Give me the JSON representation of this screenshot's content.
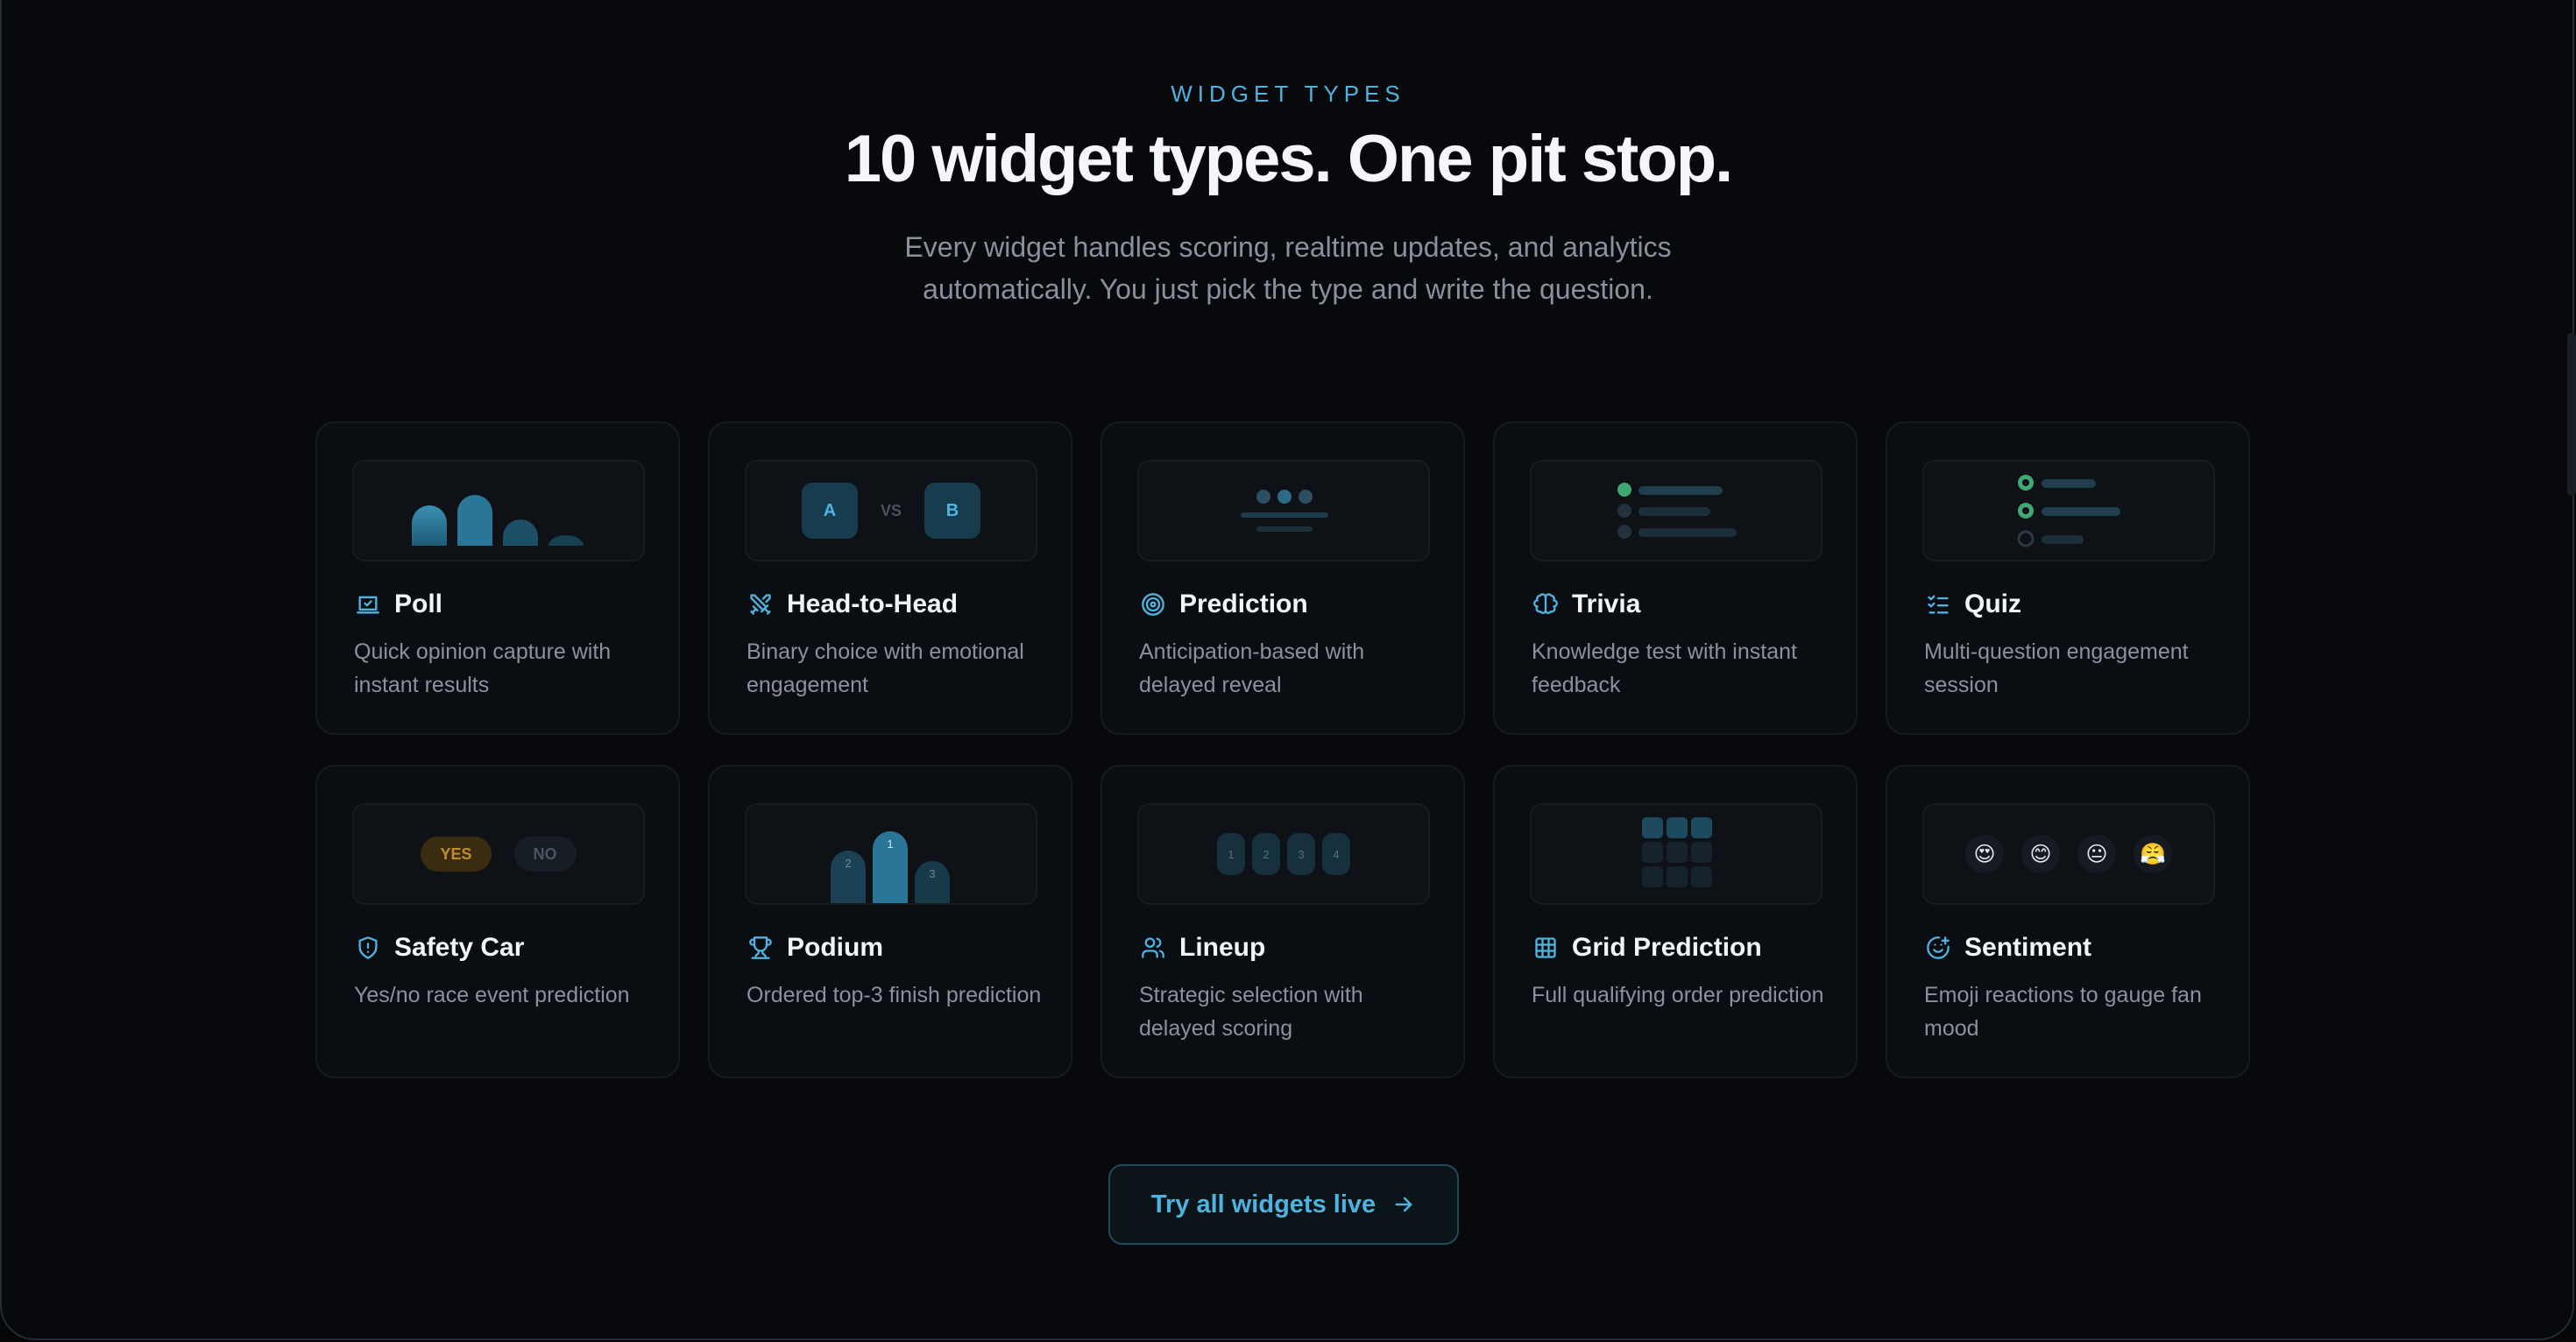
{
  "section": {
    "eyebrow": "WIDGET TYPES",
    "headline": "10 widget types. One pit stop.",
    "subhead": "Every widget handles scoring, realtime updates, and analytics automatically. You just pick the type and write the question."
  },
  "colors": {
    "accent": "#4fb3e0",
    "green": "#3fa772",
    "amber": "#c08b2a",
    "card_bg": "#0a0d11"
  },
  "widgets": [
    {
      "title": "Poll",
      "desc": "Quick opinion capture with instant results",
      "icon": "poll-icon"
    },
    {
      "title": "Head-to-Head",
      "desc": "Binary choice with emotional engagement",
      "icon": "swords-icon",
      "preview": {
        "a": "A",
        "vs": "VS",
        "b": "B"
      }
    },
    {
      "title": "Prediction",
      "desc": "Anticipation-based with delayed reveal",
      "icon": "target-icon"
    },
    {
      "title": "Trivia",
      "desc": "Knowledge test with instant feedback",
      "icon": "brain-icon"
    },
    {
      "title": "Quiz",
      "desc": "Multi-question engagement session",
      "icon": "list-checks-icon"
    },
    {
      "title": "Safety Car",
      "desc": "Yes/no race event prediction",
      "icon": "shield-icon",
      "preview": {
        "yes": "YES",
        "no": "NO"
      }
    },
    {
      "title": "Podium",
      "desc": "Ordered top-3 finish prediction",
      "icon": "trophy-icon",
      "preview": {
        "p1": "1",
        "p2": "2",
        "p3": "3"
      }
    },
    {
      "title": "Lineup",
      "desc": "Strategic selection with delayed scoring",
      "icon": "users-icon",
      "preview": {
        "slots": [
          "1",
          "2",
          "3",
          "4"
        ]
      }
    },
    {
      "title": "Grid Prediction",
      "desc": "Full qualifying order prediction",
      "icon": "grid-icon"
    },
    {
      "title": "Sentiment",
      "desc": "Emoji reactions to gauge fan mood",
      "icon": "smile-plus-icon",
      "preview": {
        "emojis": [
          "😍",
          "😊",
          "😐",
          "😤"
        ]
      }
    }
  ],
  "cta": {
    "label": "Try all widgets live",
    "icon": "arrow-right-icon"
  }
}
